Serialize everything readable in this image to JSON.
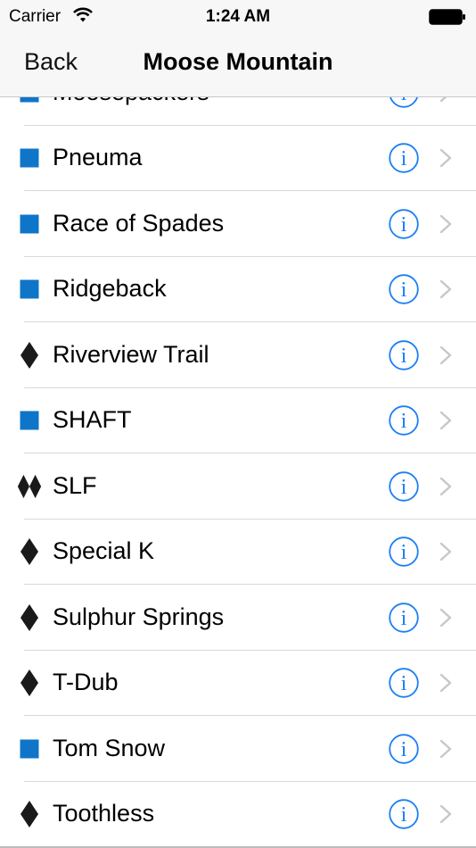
{
  "status_bar": {
    "carrier": "Carrier",
    "time": "1:24 AM"
  },
  "nav": {
    "back_label": "Back",
    "title": "Moose Mountain"
  },
  "colors": {
    "blue_square": "#0f75c9",
    "black_diamond": "#1a1a1a",
    "info_blue": "#1a7ef5",
    "chevron": "#c7c7cc"
  },
  "runs": [
    {
      "name": "Moosepackers",
      "difficulty": "blue-square"
    },
    {
      "name": "Pneuma",
      "difficulty": "blue-square"
    },
    {
      "name": "Race of Spades",
      "difficulty": "blue-square"
    },
    {
      "name": "Ridgeback",
      "difficulty": "blue-square"
    },
    {
      "name": "Riverview Trail",
      "difficulty": "black-diamond"
    },
    {
      "name": "SHAFT",
      "difficulty": "blue-square"
    },
    {
      "name": "SLF",
      "difficulty": "double-black-diamond"
    },
    {
      "name": "Special K",
      "difficulty": "black-diamond"
    },
    {
      "name": "Sulphur Springs",
      "difficulty": "black-diamond"
    },
    {
      "name": "T-Dub",
      "difficulty": "black-diamond"
    },
    {
      "name": "Tom Snow",
      "difficulty": "blue-square"
    },
    {
      "name": "Toothless",
      "difficulty": "black-diamond"
    }
  ]
}
